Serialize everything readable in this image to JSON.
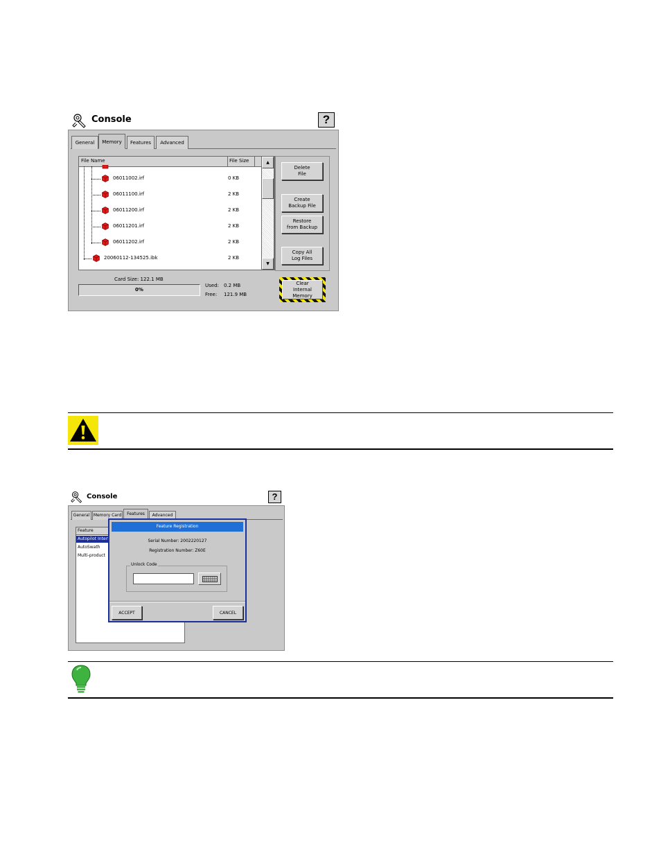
{
  "console1": {
    "title": "Console",
    "help_label": "?",
    "tabs": [
      "General",
      "Memory",
      "Features",
      "Advanced"
    ],
    "columns": [
      "File Name",
      "File Size"
    ],
    "files": [
      {
        "name": "06011002.irf",
        "size": "0 KB"
      },
      {
        "name": "06011100.irf",
        "size": "2 KB"
      },
      {
        "name": "06011200.irf",
        "size": "2 KB"
      },
      {
        "name": "06011201.irf",
        "size": "2 KB"
      },
      {
        "name": "06011202.irf",
        "size": "2 KB"
      },
      {
        "name": "20060112-134525.ibk",
        "size": "2 KB"
      }
    ],
    "buttons": {
      "delete": [
        "Delete",
        "File"
      ],
      "create": [
        "Create",
        "Backup File"
      ],
      "restore": [
        "Restore",
        "from Backup"
      ],
      "copy": [
        "Copy All",
        "Log Files"
      ],
      "clear": [
        "Clear",
        "Internal Memory"
      ]
    },
    "card_size": "Card Size:  122.1 MB",
    "progress": "0%",
    "progress_value": 0,
    "used_label": "Used:",
    "used_value": "0.2 MB",
    "free_label": "Free:",
    "free_value": "121.9 MB"
  },
  "console2": {
    "title": "Console",
    "help_label": "?",
    "tabs": [
      "General",
      "Memory Card",
      "Features",
      "Advanced"
    ],
    "list_header": "Feature",
    "features": [
      "Autopilot Interfa",
      "AutoSwath",
      "Multi-product"
    ],
    "dialog": {
      "title": "Feature Registration",
      "serial": "Serial Number: 2002220127",
      "registration": "Registration Number: Z60E",
      "unlock_label": "Unlock Code",
      "unlock_value": "",
      "accept": "ACCEPT",
      "cancel": "CANCEL"
    }
  },
  "colors": {
    "window_bg": "#c9c9c9",
    "selection": "#1a2e9c",
    "dialog_title": "#1f6fd6",
    "file_icon": "#e01818",
    "warning_yellow": "#f5e60a",
    "tip_green": "#3fb33f"
  }
}
